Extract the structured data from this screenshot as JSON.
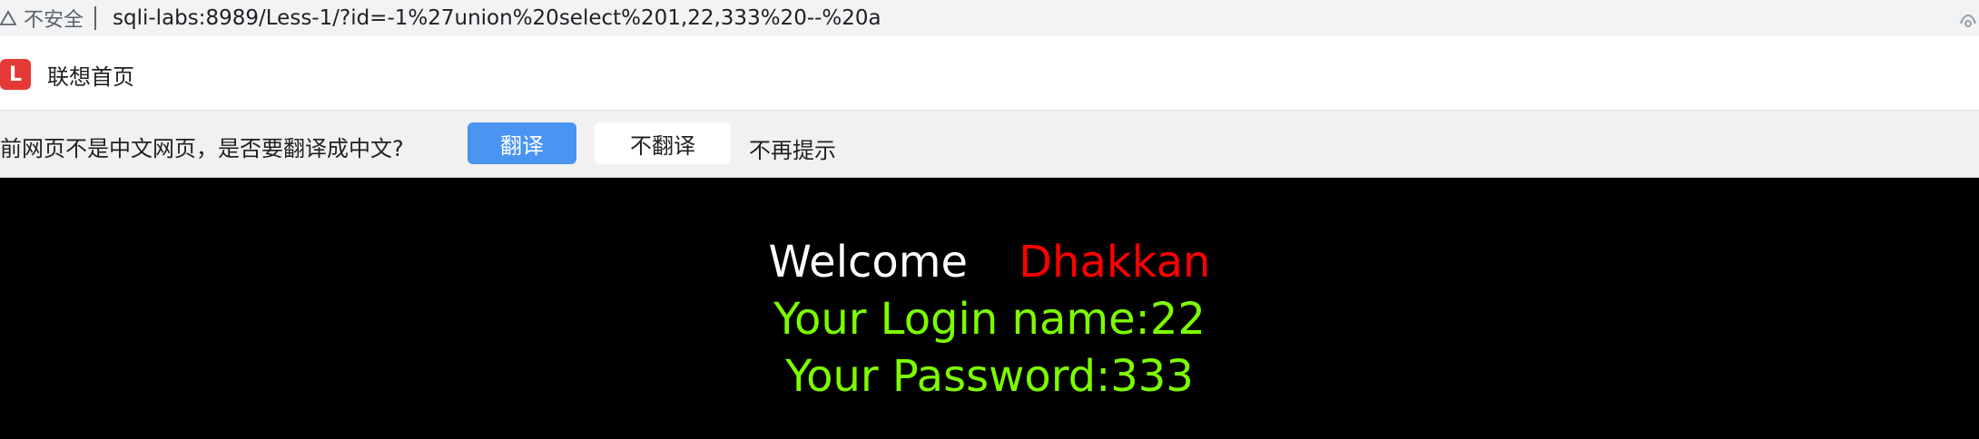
{
  "address_bar": {
    "insecure_label": "不安全",
    "url": "sqli-labs:8989/Less-1/?id=-1%27union%20select%201,22,333%20--%20a"
  },
  "bookmarks": {
    "items": [
      {
        "icon_letter": "L",
        "label": "联想首页"
      }
    ]
  },
  "translate_bar": {
    "question": "前网页不是中文网页，是否要翻译成中文?",
    "translate_button": "翻译",
    "dont_translate_button": "不翻译",
    "never_show_link": "不再提示"
  },
  "page": {
    "welcome_word": "Welcome",
    "welcome_name": "Dhakkan",
    "login_line": "Your Login name:22",
    "password_line": "Your Password:333"
  },
  "colors": {
    "translate_primary": "#4a94f2",
    "welcome_name": "#ff0000",
    "result_text": "#7cfc00",
    "page_bg": "#000000"
  }
}
